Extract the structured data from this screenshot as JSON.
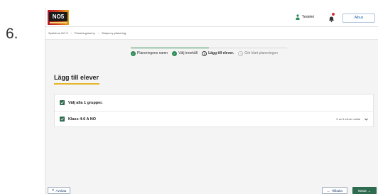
{
  "step_number": "6.",
  "header": {
    "logo_text": "NO5",
    "user_name": "Testelei",
    "close_label": "Albus",
    "brand_color": "#c52b27"
  },
  "breadcrumb": {
    "items": [
      "Spektrum NO 5",
      "Planeringsmeny",
      "Skapa ny planering"
    ]
  },
  "stepper": {
    "steps": [
      {
        "number": "1",
        "label": "Planeringens namn",
        "state": "done"
      },
      {
        "number": "2",
        "label": "Välj innehåll",
        "state": "done"
      },
      {
        "number": "3",
        "label": "Lägg till elever.",
        "state": "current"
      },
      {
        "number": "4",
        "label": "Gör klart planeringen",
        "state": "pending"
      }
    ],
    "progress": 0.5
  },
  "page": {
    "title": "Lägg till elever"
  },
  "groups": {
    "select_all_label": "Välj alla 1 grupper.",
    "rows": [
      {
        "name": "Klass 4-6 A NO",
        "count_text": "5 av 5 elever valda"
      }
    ]
  },
  "footer": {
    "cancel_label": "Avsluta",
    "back_label": "Tillbaka",
    "next_label": "Nästa"
  },
  "colors": {
    "accent_green": "#2e6b4f",
    "underline_yellow": "#e5b62a"
  }
}
